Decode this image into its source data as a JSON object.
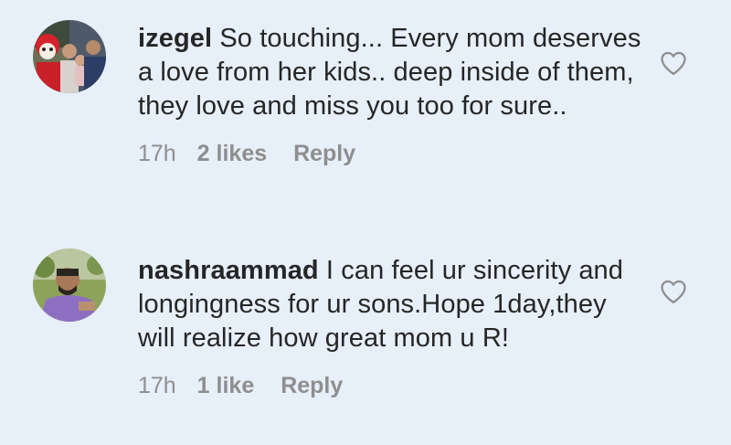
{
  "comments": [
    {
      "username": "izegel",
      "text": "So touching... Every mom deserves a love from her kids.. deep inside of them, they love and miss you too for sure..",
      "time": "17h",
      "likes": "2 likes",
      "reply_label": "Reply",
      "avatar_icon": "profile-photo-mascot",
      "like_icon": "heart-outline-icon"
    },
    {
      "username": "nashraammad",
      "text": "I can feel ur sincerity and longingness for ur sons.Hope 1day,they will realize how great mom u R!",
      "time": "17h",
      "likes": "1 like",
      "reply_label": "Reply",
      "avatar_icon": "profile-photo-man",
      "like_icon": "heart-outline-icon"
    }
  ],
  "colors": {
    "background": "#e7eff9",
    "text": "#262626",
    "meta": "#8e8e8e"
  }
}
